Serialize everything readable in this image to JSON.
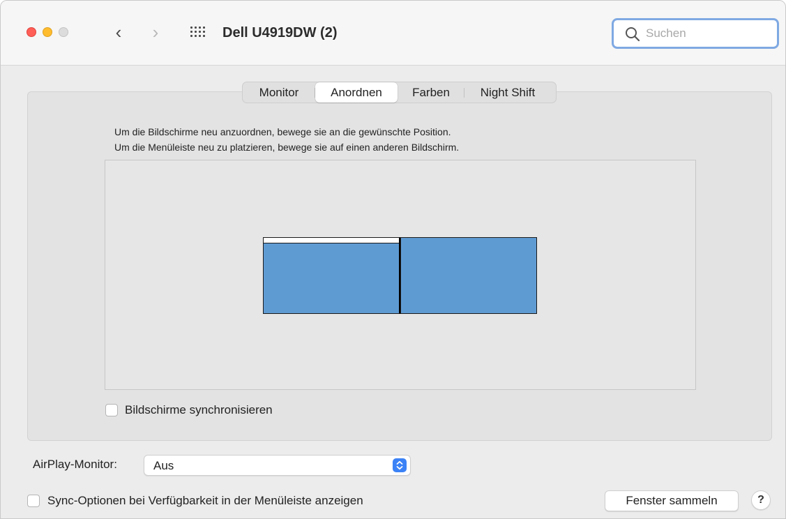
{
  "window": {
    "title": "Dell U4919DW (2)"
  },
  "titlebar": {
    "back_glyph": "‹",
    "forward_glyph": "›",
    "grid_icon": "show-all-grid-icon"
  },
  "search": {
    "placeholder": "Suchen",
    "value": ""
  },
  "tabs": [
    {
      "label": "Monitor",
      "active": false
    },
    {
      "label": "Anordnen",
      "active": true
    },
    {
      "label": "Farben",
      "active": false
    },
    {
      "label": "Night Shift",
      "active": false
    }
  ],
  "arrangement": {
    "instruction_line1": "Um die Bildschirme neu anzuordnen, bewege sie an die gewünschte Position.",
    "instruction_line2": "Um die Menüleiste neu zu platzieren, bewege sie auf einen anderen Bildschirm.",
    "display_color": "#5f9bd3",
    "displays": [
      {
        "name": "display-left",
        "has_menubar": true
      },
      {
        "name": "display-right",
        "has_menubar": false
      }
    ]
  },
  "mirror": {
    "label": "Bildschirme synchronisieren",
    "checked": false
  },
  "airplay": {
    "label": "AirPlay-Monitor:",
    "value": "Aus"
  },
  "menubar_option": {
    "label": "Sync-Optionen bei Verfügbarkeit in der Menüleiste anzeigen",
    "checked": false
  },
  "buttons": {
    "gather": "Fenster sammeln",
    "help": "?"
  },
  "colors": {
    "accent": "#3b82f6",
    "close": "#ff5f57",
    "minimize": "#febc2e"
  }
}
